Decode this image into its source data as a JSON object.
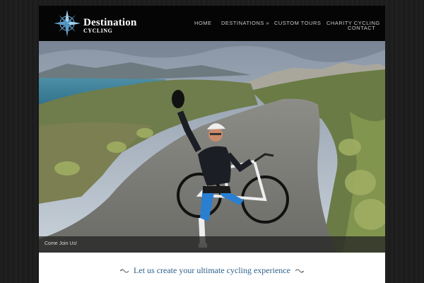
{
  "brand": {
    "name": "Destination",
    "subtitle": "CYCLING",
    "logo_icon": "compass-star-icon"
  },
  "nav": {
    "items": [
      {
        "label": "HOME"
      },
      {
        "label": "DESTINATIONS »"
      },
      {
        "label": "CUSTOM TOURS"
      },
      {
        "label": "CHARITY CYCLING"
      },
      {
        "label": "CONTACT"
      }
    ]
  },
  "hero": {
    "caption": "Come Join Us!"
  },
  "tagline": {
    "text": "Let us create your ultimate cycling experience"
  },
  "colors": {
    "accent": "#2c5f8a",
    "header_bg": "#050505",
    "nav_text": "#c8c8c8"
  }
}
